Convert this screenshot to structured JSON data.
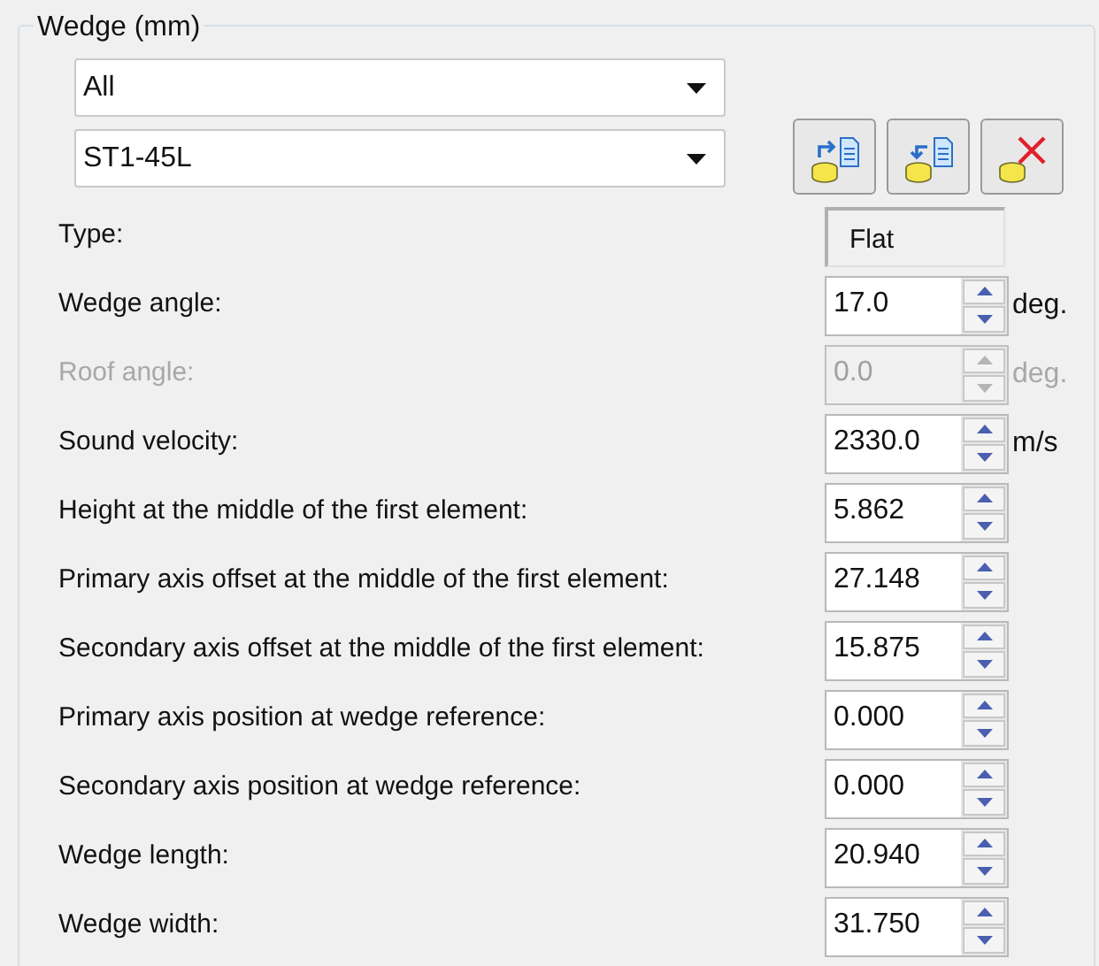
{
  "group": {
    "title": "Wedge (mm)"
  },
  "dropdowns": [
    {
      "value": "All"
    },
    {
      "value": "ST1-45L"
    }
  ],
  "toolbar": [
    {
      "kind": "export"
    },
    {
      "kind": "import"
    },
    {
      "kind": "delete"
    }
  ],
  "fields": [
    {
      "kind": "static",
      "label": "Type:",
      "value": "Flat"
    },
    {
      "kind": "spinner",
      "label": "Wedge angle:",
      "value": "17.0",
      "unit": "deg.",
      "disabled": false
    },
    {
      "kind": "spinner",
      "label": "Roof angle:",
      "value": "0.0",
      "unit": "deg.",
      "disabled": true
    },
    {
      "kind": "spinner",
      "label": "Sound velocity:",
      "value": "2330.0",
      "unit": "m/s",
      "disabled": false
    },
    {
      "kind": "spinner",
      "label": "Height at the middle of the first element:",
      "value": "5.862",
      "disabled": false
    },
    {
      "kind": "spinner",
      "label": "Primary axis offset at the middle of the first element:",
      "value": "27.148",
      "disabled": false
    },
    {
      "kind": "spinner",
      "label": "Secondary axis offset at the middle of the first element:",
      "value": "15.875",
      "disabled": false
    },
    {
      "kind": "spinner",
      "label": "Primary axis position at wedge reference:",
      "value": "0.000",
      "disabled": false
    },
    {
      "kind": "spinner",
      "label": "Secondary axis position at wedge reference:",
      "value": "0.000",
      "disabled": false
    },
    {
      "kind": "spinner",
      "label": "Wedge length:",
      "value": "20.940",
      "disabled": false
    },
    {
      "kind": "spinner",
      "label": "Wedge width:",
      "value": "31.750",
      "disabled": false
    }
  ]
}
